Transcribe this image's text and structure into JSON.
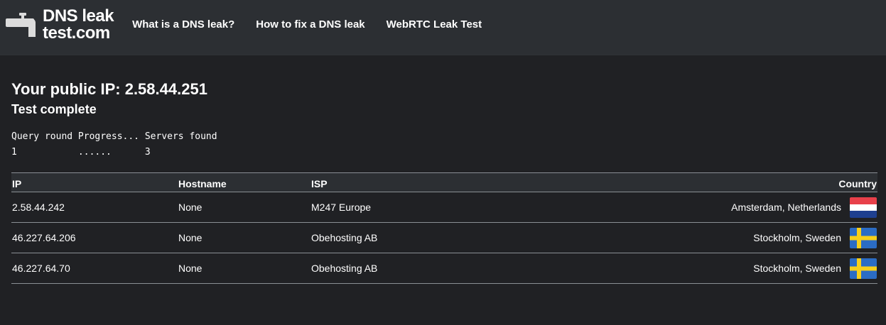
{
  "brand": {
    "line1": "DNS leak",
    "line2": "test.com"
  },
  "nav": [
    {
      "label": "What is a DNS leak?"
    },
    {
      "label": "How to fix a DNS leak"
    },
    {
      "label": "WebRTC Leak Test"
    }
  ],
  "main": {
    "public_ip_label": "Your public IP: 2.58.44.251",
    "status": "Test complete",
    "progress": {
      "header": "Query round Progress... Servers found",
      "row": "1           ......      3"
    }
  },
  "table": {
    "headers": {
      "ip": "IP",
      "hostname": "Hostname",
      "isp": "ISP",
      "country": "Country"
    },
    "rows": [
      {
        "ip": "2.58.44.242",
        "hostname": "None",
        "isp": "M247 Europe",
        "location": "Amsterdam, Netherlands",
        "flag": "netherlands-flag"
      },
      {
        "ip": "46.227.64.206",
        "hostname": "None",
        "isp": "Obehosting AB",
        "location": "Stockholm, Sweden",
        "flag": "sweden-flag"
      },
      {
        "ip": "46.227.64.70",
        "hostname": "None",
        "isp": "Obehosting AB",
        "location": "Stockholm, Sweden",
        "flag": "sweden-flag"
      }
    ]
  },
  "colors": {
    "background": "#202124",
    "navbar": "#2c2f33",
    "text": "#ffffff"
  }
}
